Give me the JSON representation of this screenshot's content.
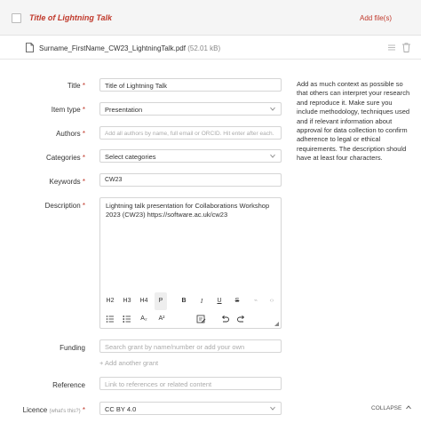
{
  "header": {
    "title": "Title of Lightning Talk",
    "add_files": "Add file(s)"
  },
  "file": {
    "name": "Surname_FirstName_CW23_LightningTalk.pdf",
    "size": "(52.01 kB)"
  },
  "form": {
    "title": {
      "label": "Title",
      "value": "Title of Lightning Talk"
    },
    "item_type": {
      "label": "Item type",
      "value": "Presentation"
    },
    "authors": {
      "label": "Authors",
      "placeholder": "Add all authors by name, full email or ORCID. Hit enter after each."
    },
    "categories": {
      "label": "Categories",
      "value": "Select categories"
    },
    "keywords": {
      "label": "Keywords",
      "value": "CW23"
    },
    "description": {
      "label": "Description",
      "value": "Lightning talk presentation for Collaborations Workshop 2023 (CW23) https://software.ac.uk/cw23",
      "toolbar": {
        "h2": "H2",
        "h3": "H3",
        "h4": "H4",
        "p": "P",
        "bold": "B",
        "italic": "I",
        "underline": "U",
        "strike": "S",
        "subscript": "A₂",
        "superscript": "A²"
      }
    },
    "funding": {
      "label": "Funding",
      "placeholder": "Search grant by name/number or add your own",
      "add_link": "+ Add another grant"
    },
    "reference": {
      "label": "Reference",
      "placeholder": "Link to references or related content"
    },
    "licence": {
      "label": "Licence",
      "hint": "(what's this?)",
      "value": "CC BY 4.0"
    }
  },
  "side_note": "Add as much context as possible so that others can interpret your research and reproduce it. Make sure you include methodology, techniques used and if relevant information about approval for data collection to confirm adherence to legal or ethical requirements. The description should have at least four characters.",
  "collapse_label": "COLLAPSE",
  "colors": {
    "accent": "#c0392b",
    "border": "#d5d5d5",
    "header_bg": "#f5f5f5"
  },
  "icons": [
    "checkbox-icon",
    "file-icon",
    "menu-icon",
    "trash-icon",
    "chevron-down-icon",
    "bullet-list-icon",
    "numbered-list-icon",
    "clear-format-icon",
    "undo-icon",
    "redo-icon",
    "chevron-up-icon"
  ]
}
